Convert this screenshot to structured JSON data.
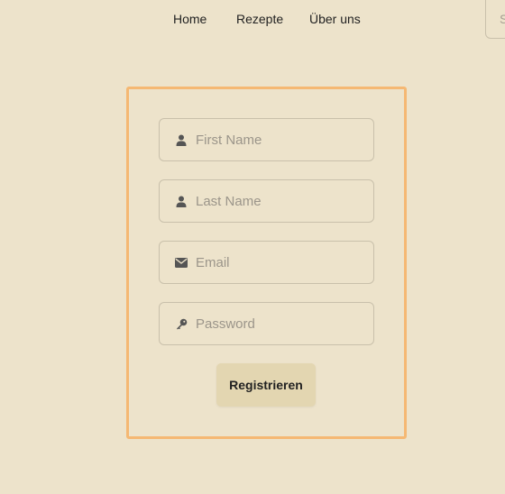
{
  "nav": {
    "items": [
      {
        "label": "Home"
      },
      {
        "label": "Rezepte"
      },
      {
        "label": "Über uns"
      }
    ],
    "search_placeholder": "S"
  },
  "form": {
    "fields": [
      {
        "placeholder": "First Name",
        "icon": "user-icon"
      },
      {
        "placeholder": "Last Name",
        "icon": "user-icon"
      },
      {
        "placeholder": "Email",
        "icon": "envelope-icon"
      },
      {
        "placeholder": "Password",
        "icon": "key-icon"
      }
    ],
    "submit_label": "Registrieren"
  },
  "colors": {
    "background": "#ede3cb",
    "card_border": "#f5b873",
    "button_bg": "#e3d6b1",
    "field_border": "#c9c0ab"
  }
}
